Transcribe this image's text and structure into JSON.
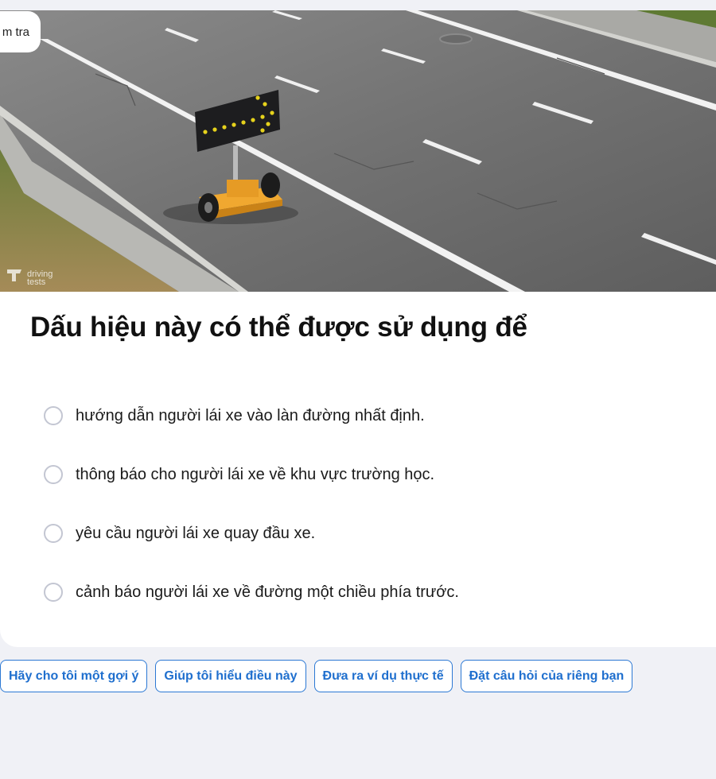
{
  "tab": {
    "label": "m tra"
  },
  "photo": {
    "watermark_line1": "driving",
    "watermark_line2": "tests"
  },
  "question": {
    "title": "Dấu hiệu này có thể được sử dụng để"
  },
  "options": [
    {
      "text": "hướng dẫn người lái xe vào làn đường nhất định."
    },
    {
      "text": "thông báo cho người lái xe về khu vực trường học."
    },
    {
      "text": "yêu cầu người lái xe quay đầu xe."
    },
    {
      "text": "cảnh báo người lái xe về đường một chiều phía trước."
    }
  ],
  "suggestions": [
    {
      "label": "Hãy cho tôi một gợi ý"
    },
    {
      "label": "Giúp tôi hiểu điều này"
    },
    {
      "label": "Đưa ra ví dụ thực tế"
    },
    {
      "label": "Đặt câu hỏi của riêng bạn"
    }
  ],
  "colors": {
    "page_background": "#f0f1f6",
    "accent": "#1f6fce",
    "radio_border": "#c3c6d2"
  }
}
